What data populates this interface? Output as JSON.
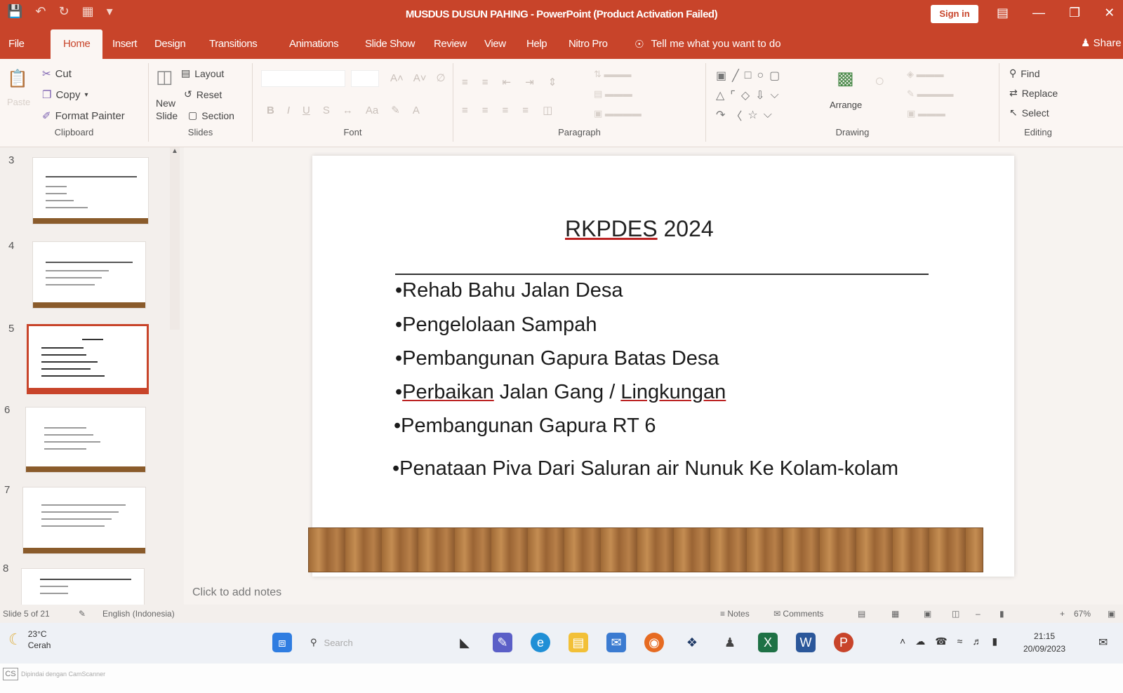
{
  "window": {
    "title": "MUSDUS DUSUN PAHING  -  PowerPoint (Product Activation Failed)",
    "sign_in": "Sign in"
  },
  "ribbon_tabs": [
    "File",
    "Home",
    "Insert",
    "Design",
    "Transitions",
    "Animations",
    "Slide Show",
    "Review",
    "View",
    "Help",
    "Nitro Pro"
  ],
  "tell_me": "Tell me what you want to do",
  "share": "Share",
  "ribbon": {
    "clipboard": {
      "label": "Clipboard",
      "cut": "Cut",
      "copy": "Copy",
      "format_painter": "Format Painter",
      "paste": "Paste"
    },
    "slides": {
      "label": "Slides",
      "new_slide": "New Slide",
      "layout": "Layout",
      "reset": "Reset",
      "section": "Section"
    },
    "font": {
      "label": "Font"
    },
    "paragraph": {
      "label": "Paragraph"
    },
    "drawing": {
      "label": "Drawing",
      "arrange": "Arrange"
    },
    "editing": {
      "label": "Editing",
      "find": "Find",
      "replace": "Replace",
      "select": "Select"
    }
  },
  "thumbnails": {
    "numbers": [
      "3",
      "4",
      "5",
      "6",
      "7",
      "8"
    ],
    "active_number": "5"
  },
  "slide": {
    "title_underlined": "RKPDES",
    "title_rest": " 2024",
    "bullets": [
      {
        "text": "•Rehab Bahu Jalan Desa"
      },
      {
        "text": "•Pengelolaan Sampah"
      },
      {
        "text": "•Pembangunan Gapura Batas Desa"
      },
      {
        "pre": "•",
        "u1": "Perbaikan",
        "mid": " Jalan Gang / ",
        "u2": "Lingkungan"
      },
      {
        "text": "•Pembangunan Gapura RT 6"
      },
      {
        "text": "•Penataan Piva Dari Saluran air Nunuk Ke Kolam-kolam"
      }
    ]
  },
  "notes_placeholder": "Click to add notes",
  "status": {
    "slide_count": "Slide 5 of 21",
    "language": "English (Indonesia)",
    "notes": "Notes",
    "comments": "Comments",
    "zoom": "67%"
  },
  "taskbar": {
    "temperature": "23°C",
    "condition": "Cerah",
    "search_placeholder": "Search",
    "time": "21:15",
    "date": "20/09/2023"
  },
  "footer": {
    "badge": "CS",
    "watermark": "Dipindai dengan CamScanner"
  },
  "colors": {
    "accent": "#c8442a",
    "wood": "#a06a36"
  }
}
